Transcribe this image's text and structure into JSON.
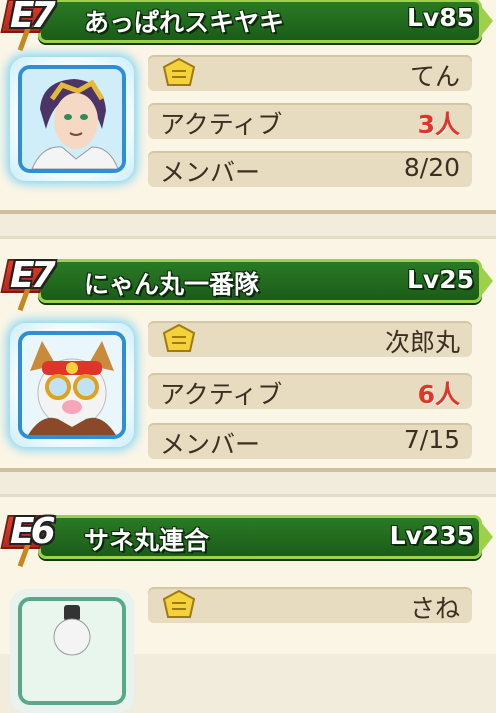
{
  "teams": [
    {
      "rank": "E7",
      "name": "あっぱれスキヤキ",
      "level": "Lv85",
      "leader": "てん",
      "active_label": "アクティブ",
      "active_count": "3人",
      "member_label": "メンバー",
      "members": "8/20"
    },
    {
      "rank": "E7",
      "name": "にゃん丸一番隊",
      "level": "Lv25",
      "leader": "次郎丸",
      "active_label": "アクティブ",
      "active_count": "6人",
      "member_label": "メンバー",
      "members": "7/15"
    },
    {
      "rank": "E6",
      "name": "サネ丸連合",
      "level": "Lv235",
      "leader": "さね"
    }
  ],
  "colors": {
    "banner_green": "#1b5c18",
    "banner_border": "#9fd04a",
    "active_red": "#e3342a",
    "row_bg": "#e7dcc0",
    "avatar_border": "#2f8fd6"
  },
  "icons": {
    "guild": "guild-crest-icon",
    "rank_flag": "rank-flag-icon"
  }
}
